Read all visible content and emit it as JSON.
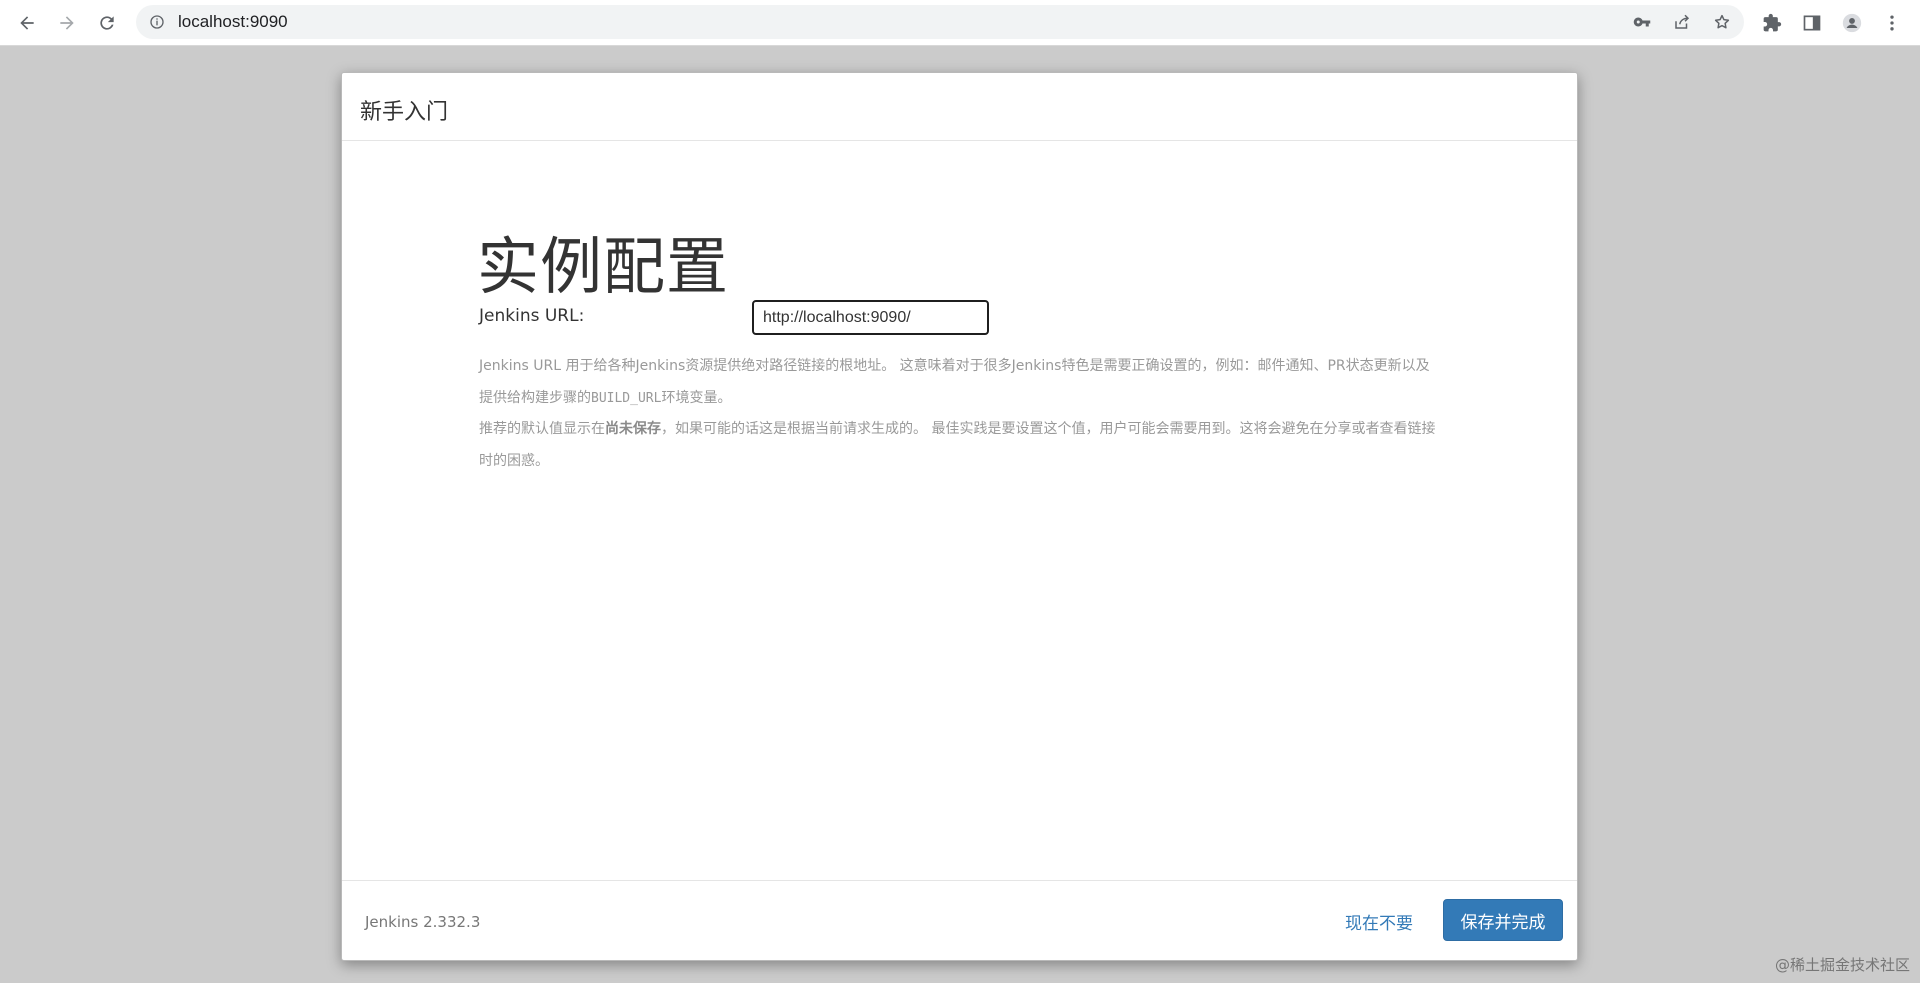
{
  "browser": {
    "url": "localhost:9090"
  },
  "dialog": {
    "title": "新手入门",
    "heading": "实例配置",
    "field_label": "Jenkins URL:",
    "url_value": "http://localhost:9090/",
    "help": {
      "p1_part1": "Jenkins URL 用于给各种Jenkins资源提供绝对路径链接的根地址。 这意味着对于很多Jenkins特色是需要正确设置的，例如：邮件通知、PR状态更新以及提供给构建步骤的",
      "p1_code": "BUILD_URL",
      "p1_part2": "环境变量。",
      "p2_part1": "推荐的默认值显示在",
      "p2_strong": "尚未保存",
      "p2_part2": "，如果可能的话这是根据当前请求生成的。 最佳实践是要设置这个值，用户可能会需要用到。这将会避免在分享或者查看链接时的困惑。"
    },
    "footer": {
      "version": "Jenkins 2.332.3",
      "skip_label": "现在不要",
      "save_label": "保存并完成"
    }
  },
  "watermark": "@稀土掘金技术社区",
  "colors": {
    "primary": "#337ab7",
    "backdrop": "#cbcbcb"
  }
}
